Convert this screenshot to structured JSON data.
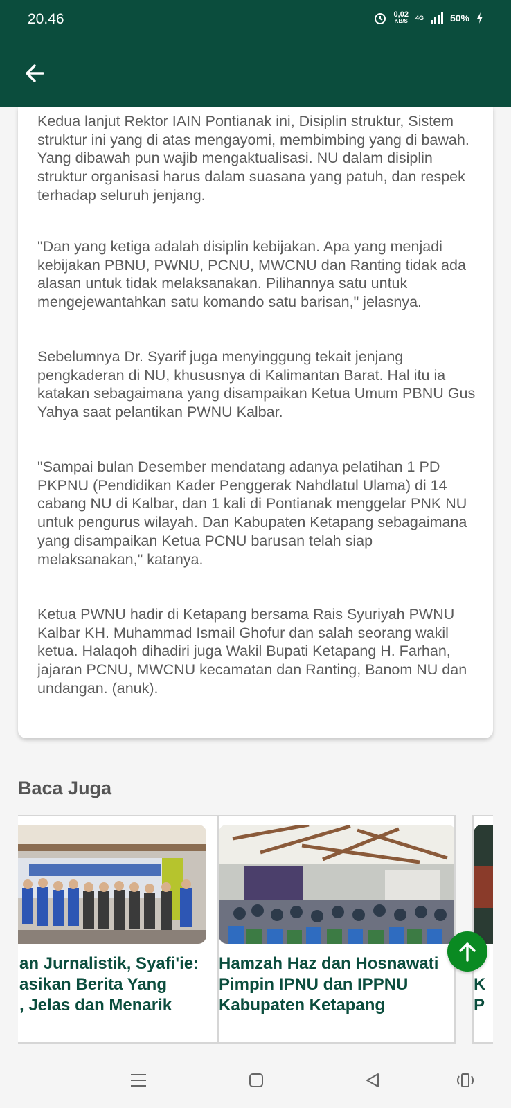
{
  "status_bar": {
    "time": "20.46",
    "net_speed_value": "0,02",
    "net_speed_unit": "KB/S",
    "network_type": "4G",
    "battery": "50%"
  },
  "article": {
    "paragraphs": [
      "Kedua lanjut Rektor IAIN Pontianak ini, Disiplin struktur, Sistem struktur ini yang di atas mengayomi, membimbing yang di bawah. Yang dibawah pun wajib mengaktualisasi. NU dalam disiplin struktur organisasi harus dalam suasana yang patuh, dan respek terhadap seluruh jenjang.",
      "\"Dan yang ketiga adalah disiplin kebijakan. Apa yang menjadi kebijakan PBNU, PWNU, PCNU, MWCNU dan Ranting tidak ada alasan untuk tidak melaksanakan. Pilihannya satu untuk mengejewantahkan satu komando satu barisan,\" jelasnya.",
      "Sebelumnya Dr. Syarif juga menyinggung tekait jenjang pengkaderan di NU, khususnya di Kalimantan Barat. Hal itu ia katakan sebagaimana yang disampaikan Ketua Umum PBNU Gus Yahya saat pelantikan PWNU Kalbar.",
      "\"Sampai bulan Desember mendatang adanya pelatihan 1 PD PKPNU (Pendidikan Kader Penggerak Nahdlatul Ulama) di 14 cabang NU di Kalbar, dan 1 kali di Pontianak menggelar PNK NU untuk pengurus wilayah. Dan Kabupaten Ketapang sebagaimana yang disampaikan Ketua PCNU barusan telah siap melaksanakan,\" katanya.",
      "Ketua PWNU hadir di Ketapang bersama Rais Syuriyah PWNU Kalbar KH. Muhammad Ismail Ghofur dan salah seorang wakil ketua. Halaqoh dihadiri juga Wakil Bupati Ketapang H. Farhan, jajaran PCNU, MWCNU kecamatan dan Ranting, Banom NU dan undangan. (anuk)."
    ]
  },
  "related": {
    "heading": "Baca Juga",
    "items": [
      {
        "title_lines": [
          "an Jurnalistik, Syafi'ie:",
          "asikan Berita Yang",
          ", Jelas dan Menarik"
        ],
        "image": "training-group-photo"
      },
      {
        "title_lines": [
          "Hamzah Haz dan Hosnawati",
          "Pimpin IPNU dan IPPNU",
          "Kabupaten Ketapang"
        ],
        "image": "hall-audience-photo"
      },
      {
        "title_lines": [
          "P",
          "K",
          "P"
        ],
        "image": "partial-photo"
      }
    ]
  },
  "colors": {
    "primary": "#0b4d3d",
    "title_green": "#0b4d3d",
    "scroll_top": "#0a8a22"
  }
}
